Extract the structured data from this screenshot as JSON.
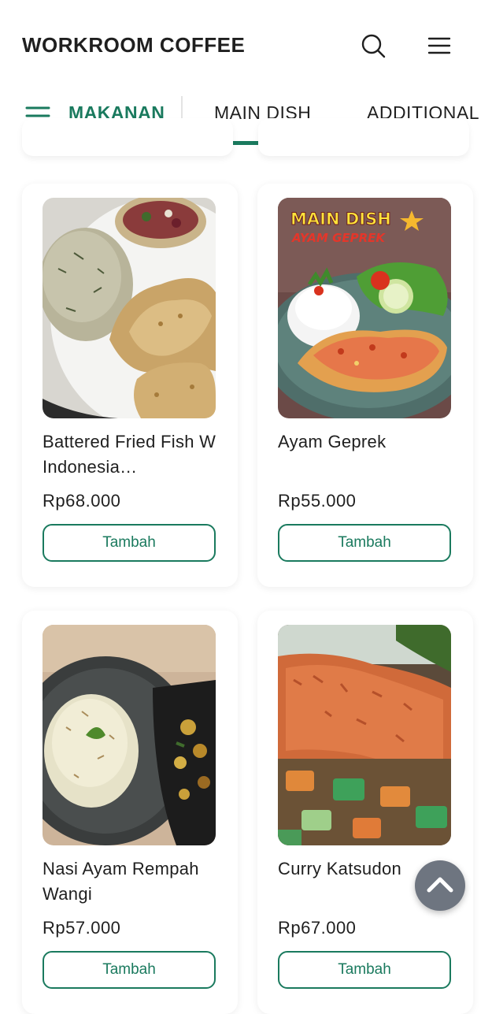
{
  "header": {
    "brand": "WORKROOM COFFEE",
    "search_icon": "search-icon",
    "menu_icon": "hamburger-menu-icon"
  },
  "tabs": {
    "category": "MAKANAN",
    "items": [
      {
        "label": "MAIN DISH",
        "active": true
      },
      {
        "label": "ADDITIONAL",
        "active": false
      }
    ]
  },
  "products": [
    {
      "name": "Battered Fried Fish W Indonesia…",
      "price": "Rp68.000",
      "button": "Tambah"
    },
    {
      "name": "Ayam Geprek",
      "price": "Rp55.000",
      "button": "Tambah",
      "image_text": [
        "MAIN DISH",
        "AYAM GEPREK"
      ]
    },
    {
      "name": "Nasi Ayam Rempah Wangi",
      "price": "Rp57.000",
      "button": "Tambah"
    },
    {
      "name": "Curry Katsudon",
      "price": "Rp67.000",
      "button": "Tambah"
    }
  ],
  "colors": {
    "accent": "#1a7a5e",
    "scroll_button": "#6e7580"
  },
  "scroll_top_icon": "chevron-up-icon"
}
